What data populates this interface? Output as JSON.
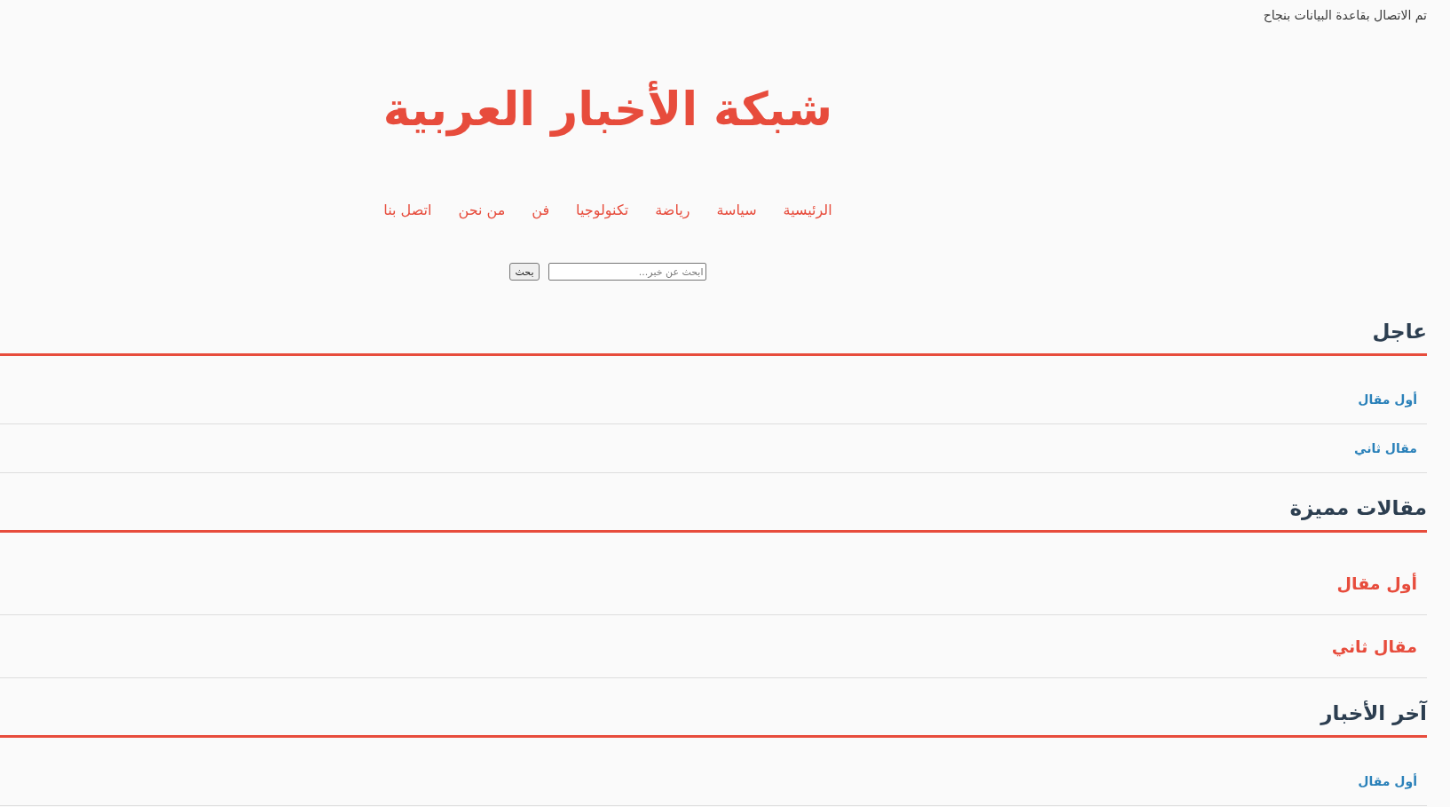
{
  "status_message": "تم الاتصال بقاعدة البيانات بنجاح",
  "site_title": "شبكة الأخبار العربية",
  "nav": [
    "الرئيسية",
    "سياسة",
    "رياضة",
    "تكنولوجيا",
    "فن",
    "من نحن",
    "اتصل بنا"
  ],
  "search": {
    "placeholder": "ابحث عن خبر...",
    "button": "بحث"
  },
  "sections": [
    {
      "title": "عاجل",
      "kind": "list",
      "items": [
        "أول مقال",
        "مقال ثاني"
      ]
    },
    {
      "title": "مقالات مميزة",
      "kind": "featured",
      "items": [
        "أول مقال",
        "مقال ثاني"
      ]
    },
    {
      "title": "آخر الأخبار",
      "kind": "list",
      "items": [
        "أول مقال"
      ]
    }
  ]
}
